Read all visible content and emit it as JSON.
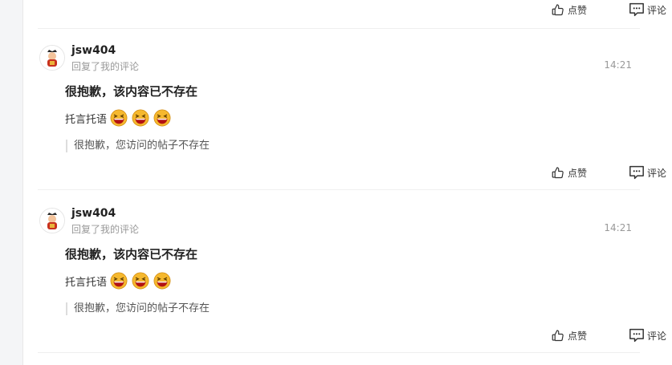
{
  "top": {
    "like_label": "点赞",
    "comment_label": "评论"
  },
  "notifications": [
    {
      "username": "jsw404",
      "subtitle": "回复了我的评论",
      "time": "14:21",
      "title": "很抱歉，该内容已不存在",
      "content_text": "托言托语",
      "emoji_count": 3,
      "quote": "很抱歉，您访问的帖子不存在",
      "like_label": "点赞",
      "comment_label": "评论"
    },
    {
      "username": "jsw404",
      "subtitle": "回复了我的评论",
      "time": "14:21",
      "title": "很抱歉，该内容已不存在",
      "content_text": "托言托语",
      "emoji_count": 3,
      "quote": "很抱歉，您访问的帖子不存在",
      "like_label": "点赞",
      "comment_label": "评论"
    }
  ],
  "colors": {
    "divider": "#efefef",
    "muted_text": "#999999",
    "emoji_face": "#f5b82e",
    "emoji_mouth": "#b31212"
  },
  "icons": {
    "like": "thumbs-up-icon",
    "comment": "comment-icon",
    "emoji": "laughing-emoji-icon",
    "avatar": "fortune-character-avatar"
  }
}
